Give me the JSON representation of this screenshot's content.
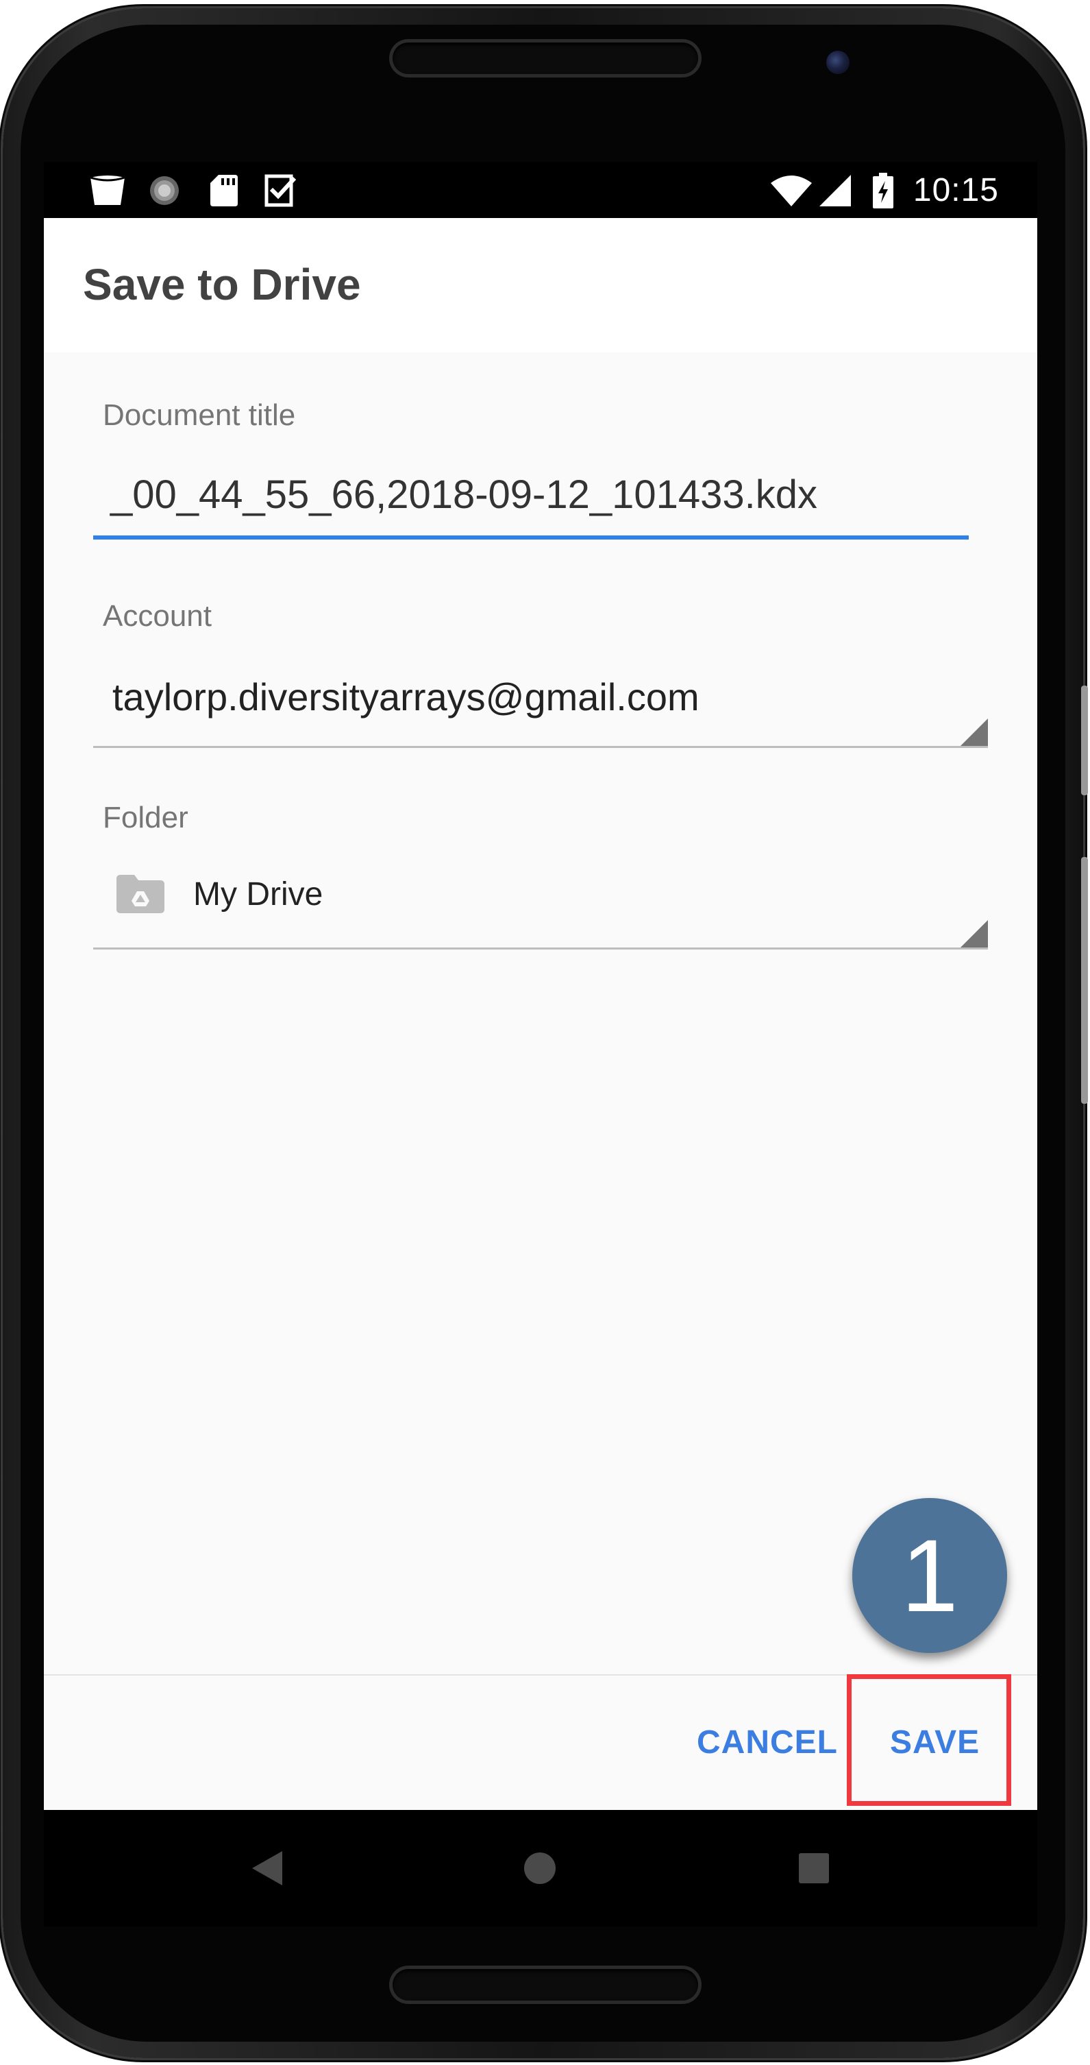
{
  "status_bar": {
    "time": "10:15",
    "left_icons": [
      "cup-icon",
      "loading-icon",
      "sd-card-icon",
      "checklist-icon"
    ],
    "right_icons": [
      "wifi-icon",
      "signal-icon",
      "battery-charging-icon"
    ]
  },
  "dialog": {
    "title": "Save to Drive",
    "document_title": {
      "label": "Document title",
      "value": "_00_44_55_66,2018-09-12_101433.kdx"
    },
    "account": {
      "label": "Account",
      "value": "taylorp.diversityarrays@gmail.com"
    },
    "folder": {
      "label": "Folder",
      "value": "My Drive",
      "icon": "drive-folder-icon"
    },
    "buttons": {
      "cancel": "CANCEL",
      "save": "SAVE"
    }
  },
  "annotation": {
    "step_number": "1",
    "highlight_color": "#f0393e",
    "callout_color": "#4d7399"
  },
  "nav_bar": {
    "icons": [
      "back-icon",
      "home-icon",
      "recents-icon"
    ]
  },
  "colors": {
    "accent": "#3b7de0",
    "active_underline": "#2f80ed"
  }
}
